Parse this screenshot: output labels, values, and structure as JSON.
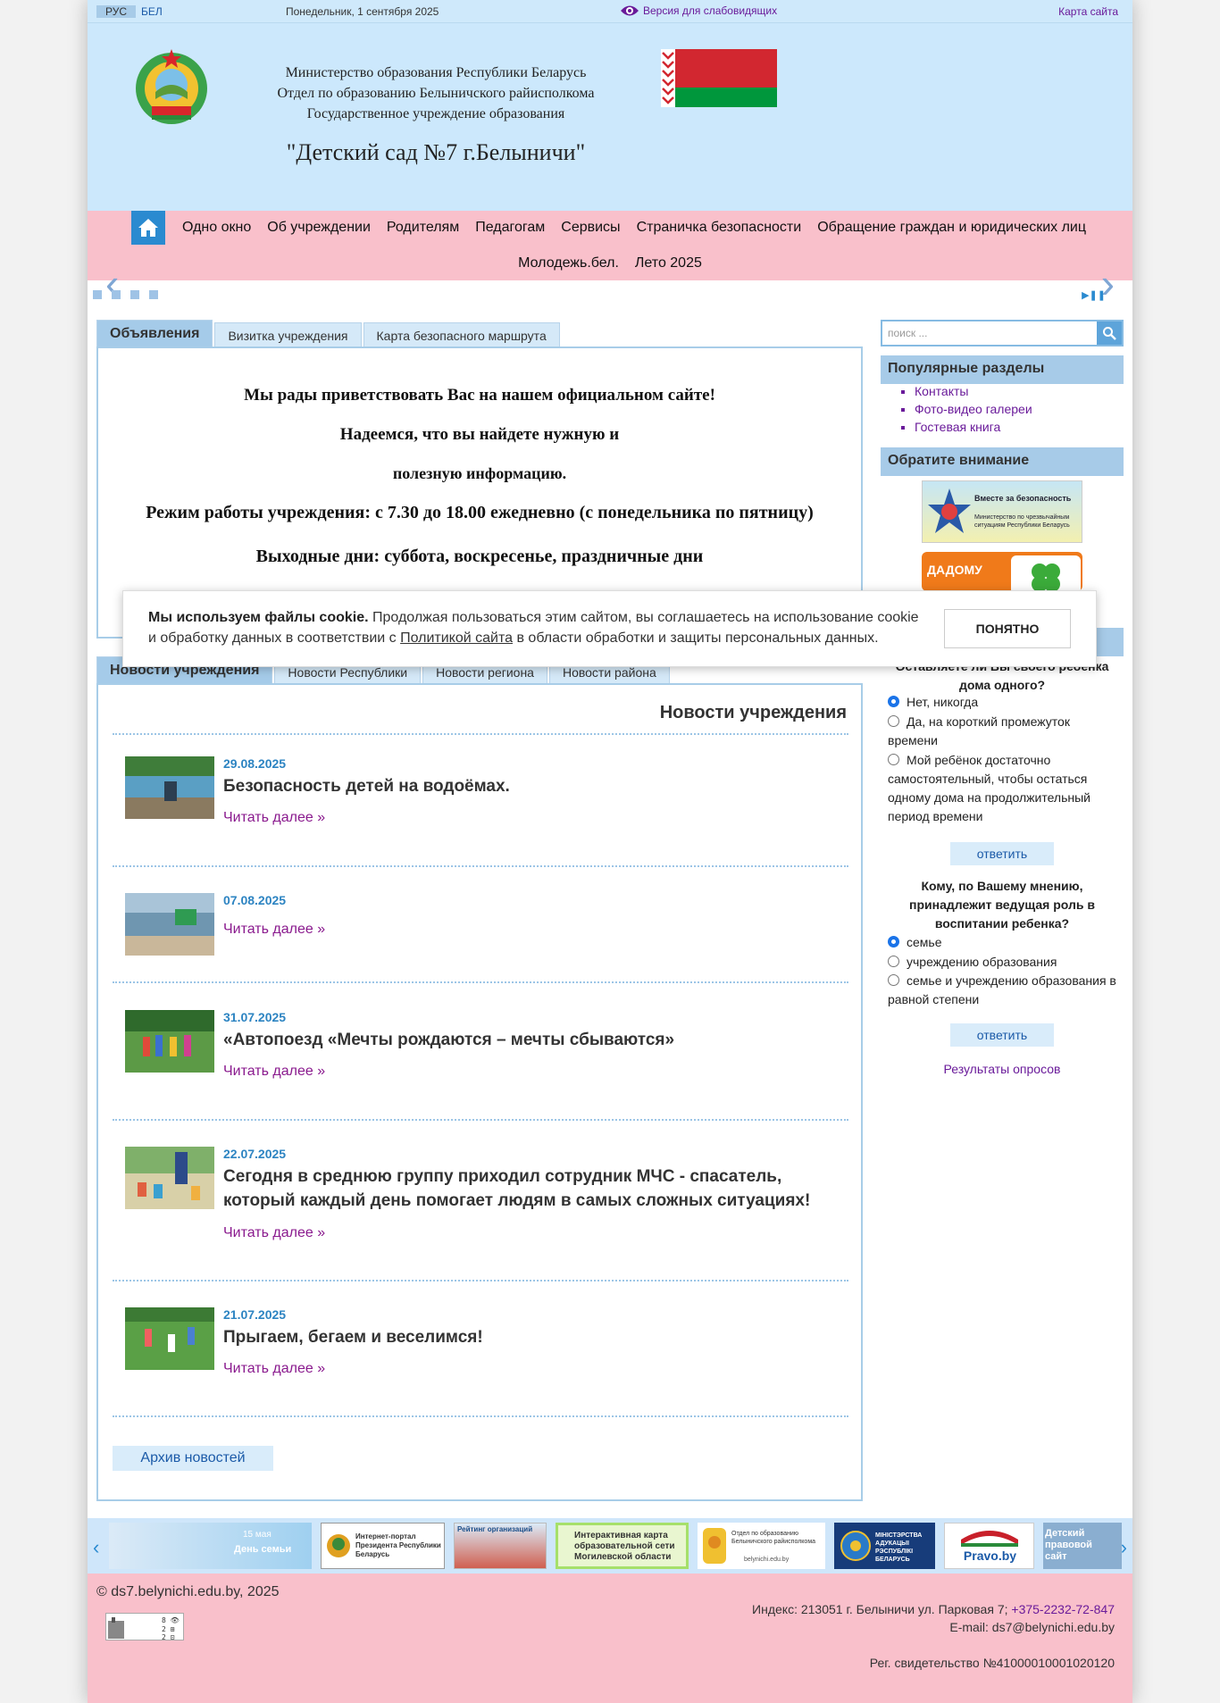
{
  "topbar": {
    "lang_ru": "РУС",
    "lang_be": "БЕЛ",
    "date": "Понедельник, 1 сентября 2025",
    "vision": "Версия для слабовидящих",
    "sitemap": "Карта сайта"
  },
  "header": {
    "org_line1": "Министерство образования Республики Беларусь",
    "org_line2": "Отдел по образованию Белыничского райисполкома",
    "org_line3": "Государственное учреждение образования",
    "kindergarten": "\"Детский сад №7 г.Белыничи\""
  },
  "nav": {
    "items_row1": [
      "Одно окно",
      "Об учреждении",
      "Родителям",
      "Педагогам",
      "Сервисы",
      "Страничка безопасности",
      "Обращение граждан и юридических лиц"
    ],
    "items_row2": [
      "Молодежь.бел.",
      "Лето 2025"
    ]
  },
  "top_tabs": [
    "Объявления",
    "Визитка учреждения",
    "Карта безопасного маршрута"
  ],
  "welcome": {
    "line1": "Мы рады приветствовать Вас на нашем официальном сайте!",
    "line2": "Надеемся, что вы найдете нужную и",
    "line3": "полезную информацию.",
    "line4": "Режим работы учреждения: с 7.30 до 18.00 ежедневно (с понедельника по пятницу)",
    "line5": "Выходные дни: суббота, воскресенье, праздничные дни"
  },
  "news_tabs": [
    "Новости учреждения",
    "Новости Республики",
    "Новости региона",
    "Новости района"
  ],
  "news": {
    "heading": "Новости учреждения",
    "read_more": "Читать далее »",
    "archive": "Архив новостей",
    "items": [
      {
        "date": "29.08.2025",
        "title": "Безопасность детей на водоёмах."
      },
      {
        "date": "07.08.2025",
        "title": ""
      },
      {
        "date": "31.07.2025",
        "title": "«Автопоезд «Мечты рождаются – мечты сбываются»"
      },
      {
        "date": "22.07.2025",
        "title": "Сегодня в среднюю группу приходил сотрудник МЧС - спасатель, который каждый день помогает людям в самых сложных ситуациях!"
      },
      {
        "date": "21.07.2025",
        "title": "Прыгаем, бегаем и веселимся!"
      }
    ]
  },
  "sidebar": {
    "search_placeholder": "поиск ...",
    "popular_heading": "Популярные разделы",
    "popular_links": [
      "Контакты",
      "Фото-видео галереи",
      "Гостевая книга"
    ],
    "attention_heading": "Обратите внимание",
    "banner1_text": "Вместе за безопасность",
    "banner1_sub": "Министерство по чрезвычайным ситуациям Республики Беларусь",
    "banner2_text": "ДАДОМУ"
  },
  "poll": {
    "q1": "Оставляете ли Вы своего ребенка дома одного?",
    "q1_options": [
      "Нет, никогда",
      "Да, на короткий промежуток времени",
      "Мой ребёнок достаточно самостоятельный, чтобы остаться одному дома на продолжительный период времени"
    ],
    "q2": "Кому, по Вашему мнению, принадлежит ведущая роль в воспитании ребенка?",
    "q2_options": [
      "семье",
      "учреждению образования",
      "семье и учреждению образования в равной степени"
    ],
    "vote": "ответить",
    "results": "Результаты опросов"
  },
  "cookie": {
    "bold": "Мы используем файлы cookie.",
    "text1": " Продолжая пользоваться этим сайтом, вы соглашаетесь на использование cookie и обработку данных в соответствии с ",
    "link": "Политикой сайта",
    "text2": " в области обработки и защиты персональных данных.",
    "button": "ПОНЯТНО"
  },
  "partners": {
    "b1": "День семьи",
    "b1_date": "15 мая",
    "b2": "Интернет-портал Президента Республики Беларусь",
    "b3": "Рейтинг организаций",
    "b4": "Интерактивная карта образовательной сети Могилевской области",
    "b5": "Отдел по образованию Белыничского райисполкома",
    "b5_url": "belynichi.edu.by",
    "b6": "МІНІСТЭРСТВА АДУКАЦЫІ РЭСПУБЛІКІ БЕЛАРУСЬ",
    "b7": "Pravo.by",
    "b8": "Детский правовой сайт"
  },
  "footer": {
    "copyright": "© ds7.belynichi.edu.by, 2025",
    "address": "Индекс: 213051 г. Белыничи ул. Парковая 7;",
    "phone": "+375-2232-72-847",
    "email": "E-mail: ds7@belynichi.edu.by",
    "registration": "Рег. свидетельство №41000010001020120"
  },
  "colors": {
    "header_bg": "#cce8fc",
    "nav_bg": "#f9c0cb",
    "accent": "#2a8ad0",
    "link": "#6a1b9a"
  }
}
